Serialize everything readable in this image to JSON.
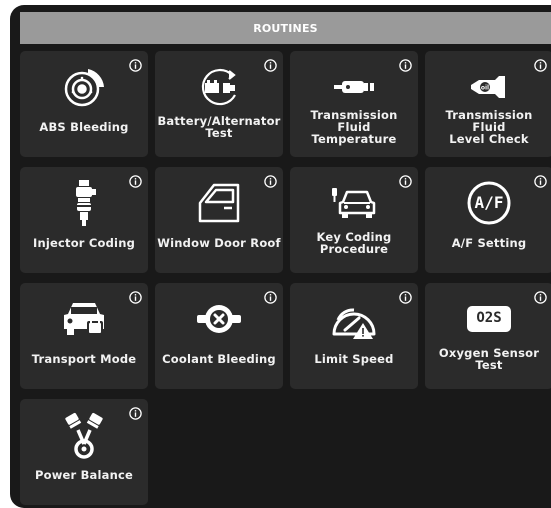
{
  "header": {
    "title": "ROUTINES"
  },
  "tiles": [
    {
      "label": "ABS Bleeding",
      "icon": "brake-disc-icon"
    },
    {
      "label": "Battery/Alternator\nTest",
      "icon": "battery-alternator-icon"
    },
    {
      "label": "Transmission Fluid\nTemperature",
      "icon": "fluid-temperature-icon"
    },
    {
      "label": "Transmission Fluid\nLevel Check",
      "icon": "fluid-level-icon"
    },
    {
      "label": "Injector Coding",
      "icon": "injector-icon"
    },
    {
      "label": "Window Door Roof",
      "icon": "car-door-icon"
    },
    {
      "label": "Key Coding\nProcedure",
      "icon": "key-car-icon"
    },
    {
      "label": "A/F Setting",
      "icon": "af-badge-icon",
      "badge": "A/F"
    },
    {
      "label": "Transport Mode",
      "icon": "car-lock-icon"
    },
    {
      "label": "Coolant Bleeding",
      "icon": "coolant-icon"
    },
    {
      "label": "Limit Speed",
      "icon": "speedometer-warning-icon"
    },
    {
      "label": "Oxygen Sensor\nTest",
      "icon": "o2s-sensor-icon",
      "badge": "O2S"
    },
    {
      "label": "Power Balance",
      "icon": "pistons-icon"
    }
  ],
  "colors": {
    "background": "#191919",
    "tile": "#2b2b2b",
    "header": "#9a9a9a",
    "text": "#f2f2f2"
  }
}
